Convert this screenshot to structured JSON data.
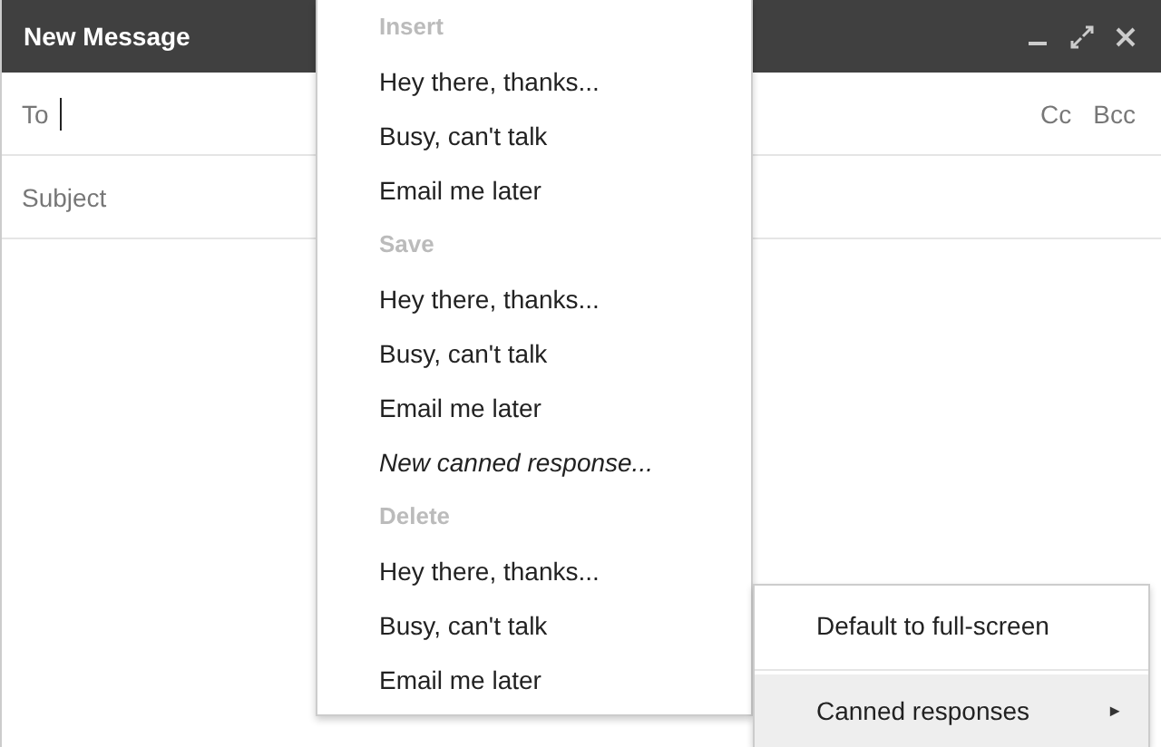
{
  "window": {
    "title": "New Message"
  },
  "fields": [
    {
      "kind": "to",
      "label": "To",
      "links": [
        "Cc",
        "Bcc"
      ]
    },
    {
      "kind": "subject",
      "placeholder": "Subject"
    }
  ],
  "canned_menu": {
    "sections": [
      {
        "heading": "Insert",
        "items": [
          {
            "label": "Hey there, thanks...",
            "kind": "response"
          },
          {
            "label": "Busy, can't talk",
            "kind": "response"
          },
          {
            "label": "Email me later",
            "kind": "response"
          }
        ]
      },
      {
        "heading": "Save",
        "items": [
          {
            "label": "Hey there, thanks...",
            "kind": "response"
          },
          {
            "label": "Busy, can't talk",
            "kind": "response"
          },
          {
            "label": "Email me later",
            "kind": "response"
          },
          {
            "label": "New canned response...",
            "kind": "new"
          }
        ]
      },
      {
        "heading": "Delete",
        "items": [
          {
            "label": "Hey there, thanks...",
            "kind": "response"
          },
          {
            "label": "Busy, can't talk",
            "kind": "response"
          },
          {
            "label": "Email me later",
            "kind": "response"
          }
        ]
      }
    ]
  },
  "options_menu": {
    "items": [
      {
        "label": "Default to full-screen",
        "selected": false
      },
      {
        "label": "Canned responses",
        "selected": true,
        "arrow": "►"
      }
    ]
  }
}
